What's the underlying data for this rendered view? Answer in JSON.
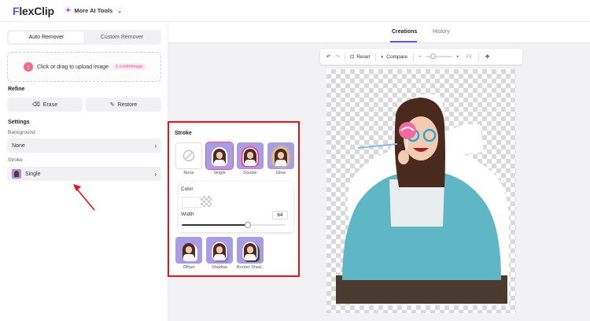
{
  "app": {
    "logo_text": "lexClip",
    "logo_initial": "F"
  },
  "header": {
    "ai_tools_label": "More AI Tools"
  },
  "left": {
    "tabs": [
      "Auto Remover",
      "Custom Remover"
    ],
    "upload_text": "Click or drag to upload image",
    "credit_badge": "1 credit/image",
    "refine_heading": "Refine",
    "erase_label": "Erase",
    "restore_label": "Restore",
    "settings_heading": "Settings",
    "background_label": "Background",
    "background_value": "None",
    "stroke_label": "Stroke",
    "stroke_value": "Single"
  },
  "stroke_popup": {
    "title": "Stroke",
    "options": [
      "None",
      "Single",
      "Double",
      "Glow",
      "Offset",
      "Shadow",
      "Border Shad..."
    ],
    "selected": "Single",
    "color_label": "Color",
    "width_label": "Width",
    "width_value": "64",
    "width_fraction": 0.64
  },
  "canvas": {
    "tabs": [
      "Creations",
      "History"
    ],
    "toolbar": {
      "reset_label": "Reset",
      "compare_label": "Compare",
      "fit_label": "Fit"
    }
  },
  "colors": {
    "accent": "#6c4ff5",
    "highlight_border": "#e3141c",
    "selected_stroke": "#e94b9b"
  }
}
